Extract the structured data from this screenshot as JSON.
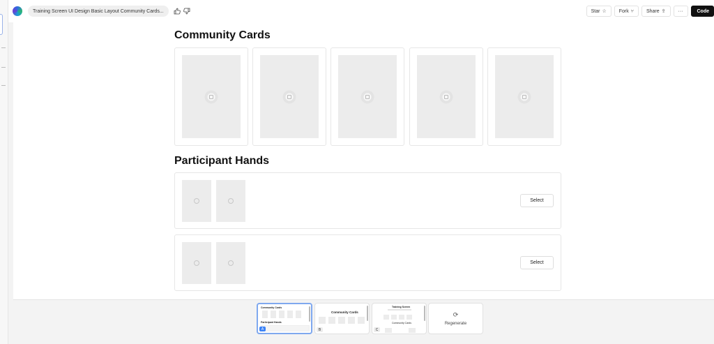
{
  "topbar": {
    "title": "Training Screen UI Design Basic Layout Community Cards...",
    "like_icon": "thumbs-up-icon",
    "dislike_icon": "thumbs-down-icon",
    "star_label": "Star",
    "fork_label": "Fork",
    "share_label": "Share",
    "more_label": "···",
    "code_label": "Code"
  },
  "main": {
    "community_title": "Community Cards",
    "community_cards_count": 5,
    "hands_title": "Participant Hands",
    "hands": [
      {
        "select_label": "Select"
      },
      {
        "select_label": "Select"
      }
    ]
  },
  "versions": [
    {
      "badge": "A",
      "title": "Community Cards",
      "subtitle": "Participant Hands",
      "active": true
    },
    {
      "badge": "B",
      "title": "Community Cards",
      "active": false
    },
    {
      "badge": "C",
      "title": "Training Screen",
      "subtitle": "Community Cards",
      "active": false
    }
  ],
  "regenerate_label": "Regenerate",
  "colors": {
    "accent": "#3b82f6",
    "code_button": "#111111",
    "placeholder": "#ececec"
  }
}
